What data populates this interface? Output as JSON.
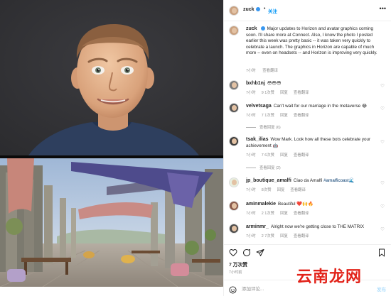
{
  "header": {
    "username": "zuck",
    "follow_label": "关注",
    "dot": "•",
    "more_icon": "more-horizontal-icon"
  },
  "caption": {
    "username": "zuck",
    "text": "Major updates to Horizon and avatar graphics coming soon. I'll share more at Connect. Also, I know the photo I posted earlier this week was pretty basic -- it was taken very quickly to celebrate a launch. The graphics in Horizon are capable of much more -- even on headsets -- and Horizon is improving very quickly.",
    "time": "7小时",
    "translate": "查看翻译"
  },
  "comments": [
    {
      "username": "bxhb1nj",
      "text": "😳😳😳",
      "time": "7小时",
      "likes": "9 1次赞",
      "reply": "回复",
      "translate": "查看翻译"
    },
    {
      "username": "velvetsaga",
      "text": "Can't wait for our marriage in the metaverse 😂",
      "time": "7小时",
      "likes": "7 1次赞",
      "reply": "回复",
      "translate": "查看翻译",
      "replies": "查看回复 (6)"
    },
    {
      "username": "tsak_ilias",
      "text": "Wow Mark. Look how all these bots celebrate your achievement 🤖",
      "time": "7小时",
      "likes": "7 6次赞",
      "reply": "回复",
      "translate": "查看翻译",
      "replies": "查看回复 (2)"
    },
    {
      "username": "jp_boutique_amalfi",
      "text": "Ciao da Amalfi",
      "hashtag": "#amalficoast",
      "emoji": "🌊",
      "time": "7小时",
      "likes": "8次赞",
      "reply": "回复",
      "translate": "查看翻译"
    },
    {
      "username": "aminmalekie",
      "text": "Beautiful ❤️🙌🔥",
      "time": "7小时",
      "likes": "2 1次赞",
      "reply": "回复",
      "translate": "查看翻译"
    },
    {
      "username": "arminmr_",
      "text": "Alright now we're getting close to THE MATRIX",
      "time": "7小时",
      "likes": "2 7次赞",
      "reply": "回复",
      "translate": "查看翻译"
    }
  ],
  "post": {
    "likes": "7 万次赞",
    "time": "7小时前"
  },
  "composer": {
    "placeholder": "添加评论...",
    "post_label": "发布"
  },
  "watermark": "云南龙网",
  "colors": {
    "link_blue": "#0095f6",
    "verified_blue": "#3897f0",
    "meta_gray": "#8e8e8e",
    "watermark_red": "#e2231a"
  }
}
